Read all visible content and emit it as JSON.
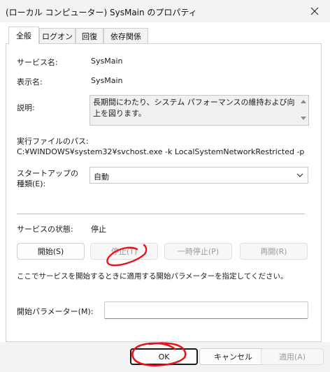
{
  "window": {
    "title": "(ローカル コンピューター) SysMain のプロパティ"
  },
  "tabs": [
    {
      "label": "全般"
    },
    {
      "label": "ログオン"
    },
    {
      "label": "回復"
    },
    {
      "label": "依存関係"
    }
  ],
  "general": {
    "service_name_label": "サービス名:",
    "service_name_value": "SysMain",
    "display_name_label": "表示名:",
    "display_name_value": "SysMain",
    "description_label": "説明:",
    "description_value": "長期間にわたり、システム パフォーマンスの維持および向上を図ります。",
    "exe_path_label": "実行ファイルのパス:",
    "exe_path_value": "C:¥WINDOWS¥system32¥svchost.exe -k LocalSystemNetworkRestricted -p",
    "startup_type_label_line1": "スタートアップの",
    "startup_type_label_line2": "種類(E):",
    "startup_type_value": "自動",
    "status_label": "サービスの状態:",
    "status_value": "停止",
    "buttons": {
      "start": "開始(S)",
      "stop": "停止(T)",
      "pause": "一時停止(P)",
      "resume": "再開(R)"
    },
    "hint": "ここでサービスを開始するときに適用する開始パラメーターを指定してください。",
    "param_label": "開始パラメーター(M):",
    "param_value": ""
  },
  "footer": {
    "ok": "OK",
    "cancel": "キャンセル",
    "apply": "適用(A)"
  },
  "colors": {
    "annotation_red": "#e8141c",
    "window_bg": "#f3f3f3",
    "disabled_text": "#9b9b9b"
  },
  "icons": [
    "close-icon",
    "chevron-down-icon",
    "scroll-up-icon",
    "scroll-down-icon"
  ]
}
